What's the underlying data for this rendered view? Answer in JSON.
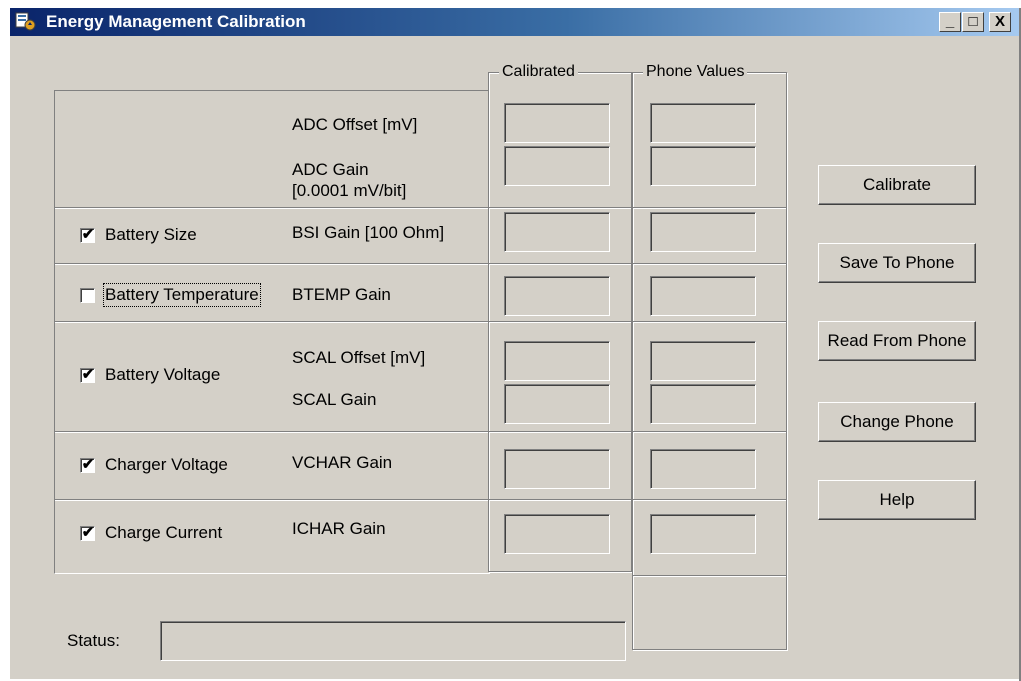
{
  "window": {
    "title": "Energy Management Calibration",
    "controls": {
      "minimize": "_",
      "maximize": "□",
      "close": "X"
    }
  },
  "columns": {
    "calibrated": "Calibrated",
    "phone_values": "Phone Values"
  },
  "rows": {
    "adc": {
      "label1": "ADC Offset [mV]",
      "label2_line1": "ADC Gain",
      "label2_line2": "[0.0001 mV/bit]"
    },
    "battery_size": {
      "checkbox": "Battery Size",
      "checked": true,
      "param": "BSI Gain [100 Ohm]"
    },
    "battery_temperature": {
      "checkbox": "Battery Temperature",
      "checked": false,
      "param": "BTEMP Gain"
    },
    "battery_voltage": {
      "checkbox": "Battery Voltage",
      "checked": true,
      "param1": "SCAL Offset [mV]",
      "param2": "SCAL Gain"
    },
    "charger_voltage": {
      "checkbox": "Charger Voltage",
      "checked": true,
      "param": "VCHAR Gain"
    },
    "charge_current": {
      "checkbox": "Charge Current",
      "checked": true,
      "param": "ICHAR Gain"
    }
  },
  "buttons": {
    "calibrate": "Calibrate",
    "save_to_phone": "Save To Phone",
    "read_from_phone": "Read From Phone",
    "change_phone": "Change Phone",
    "help": "Help"
  },
  "status": {
    "label": "Status:",
    "value": ""
  }
}
